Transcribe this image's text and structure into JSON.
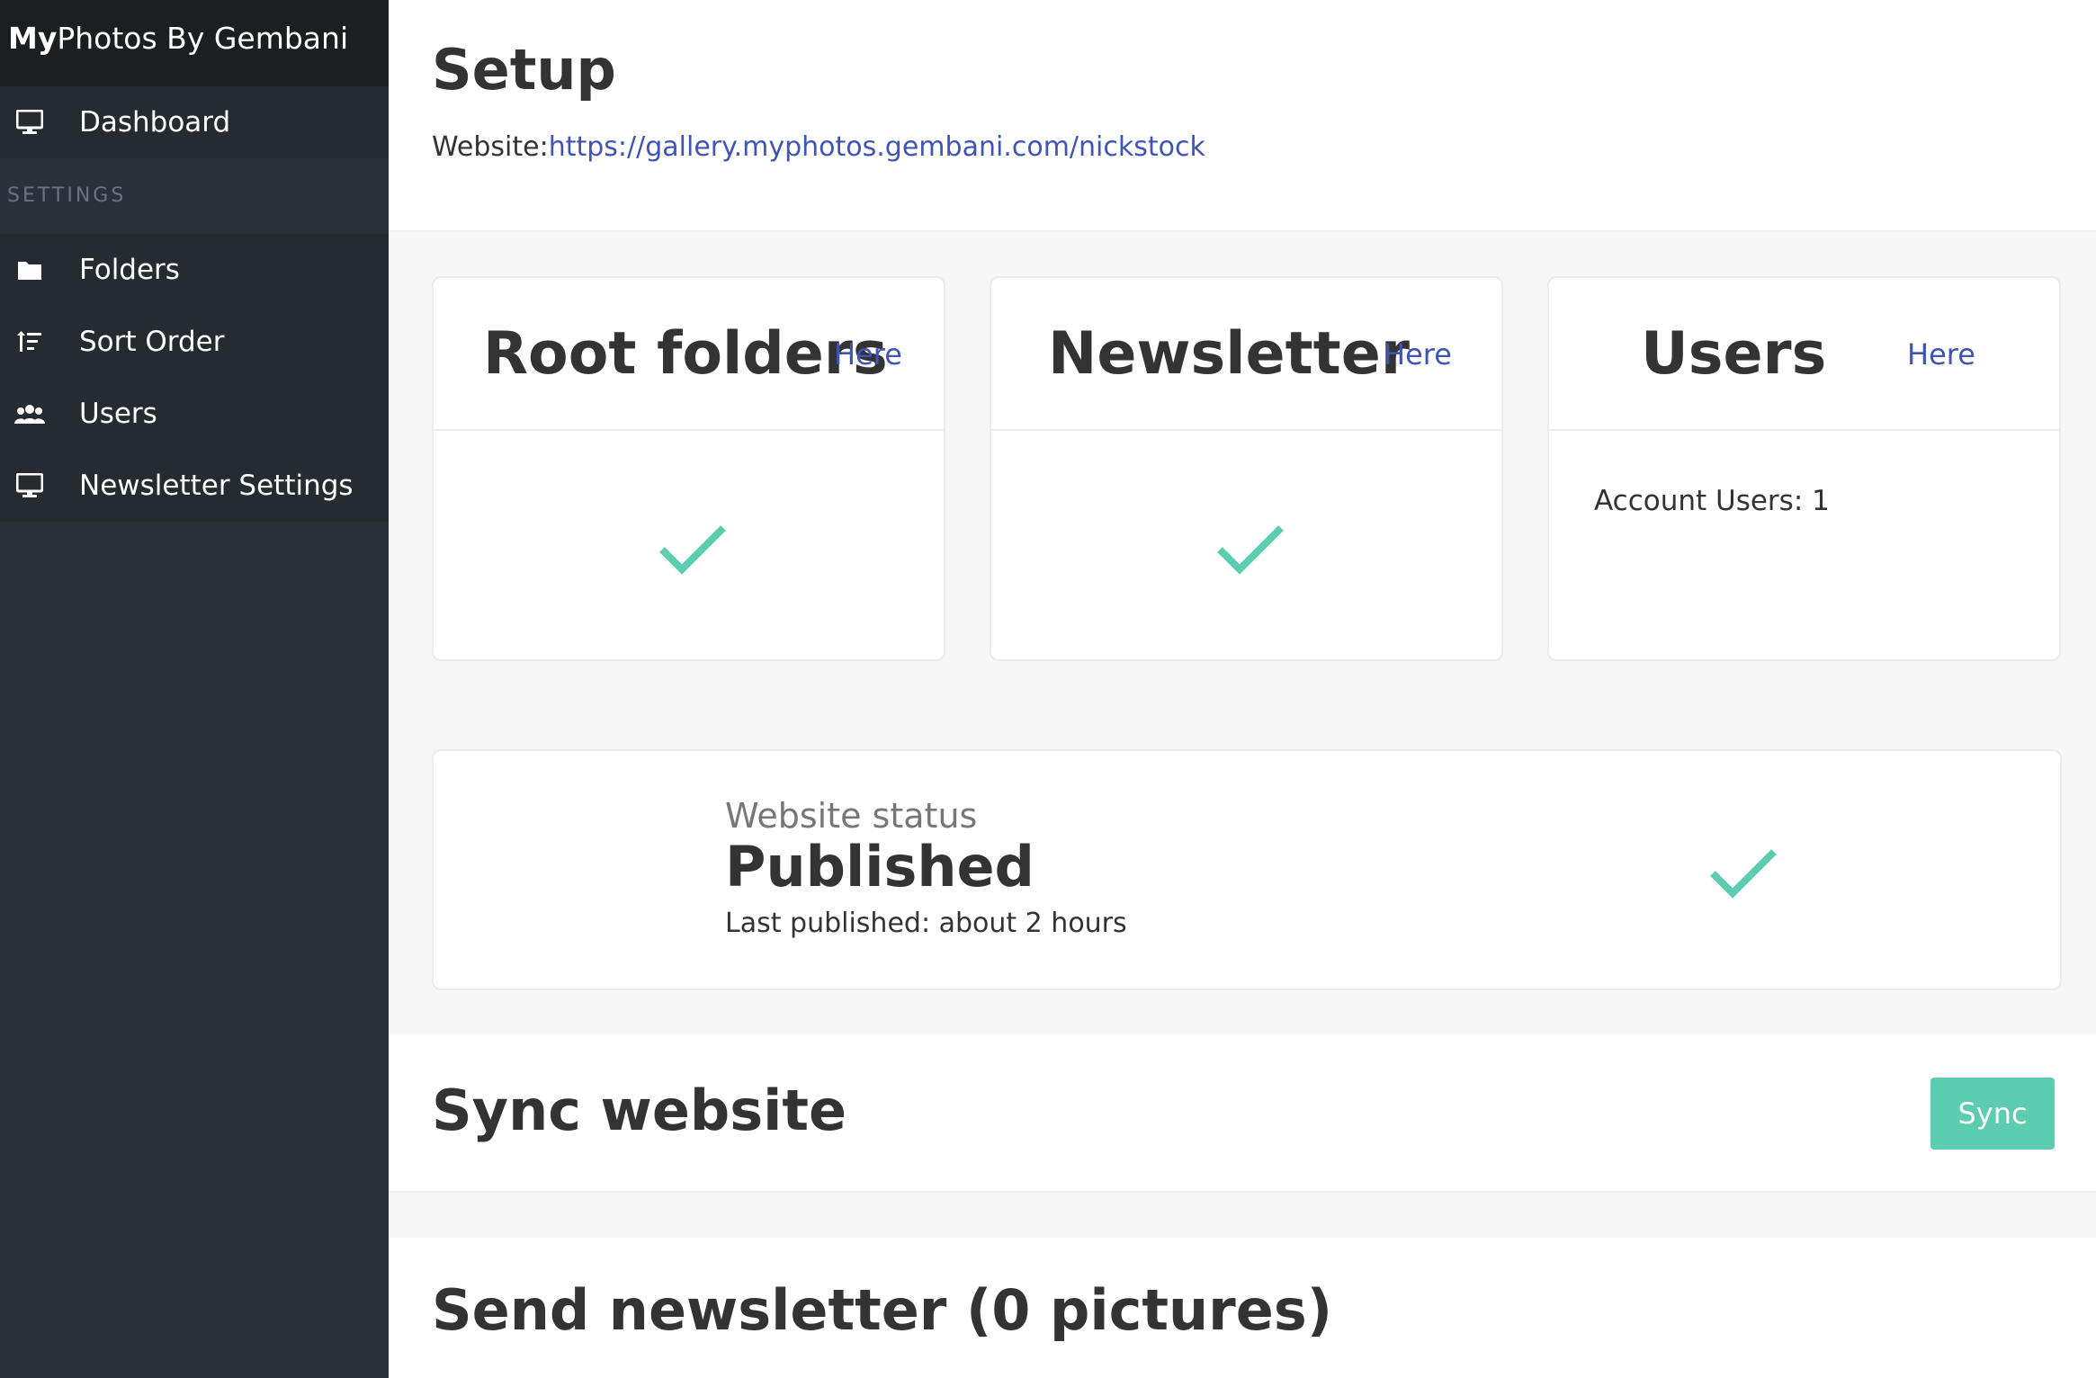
{
  "brand": {
    "bold": "My",
    "rest": "Photos By Gembani"
  },
  "sidebar": {
    "dashboard": {
      "label": "Dashboard",
      "icon": "monitor-icon"
    },
    "section_label": "SETTINGS",
    "items": [
      {
        "label": "Folders",
        "icon": "folder-icon"
      },
      {
        "label": "Sort Order",
        "icon": "sort-icon"
      },
      {
        "label": "Users",
        "icon": "users-icon"
      },
      {
        "label": "Newsletter Settings",
        "icon": "monitor-icon"
      }
    ]
  },
  "header": {
    "title": "Setup",
    "website_label": "Website:",
    "website_url": "https://gallery.myphotos.gembani.com/nickstock"
  },
  "cards": {
    "root_folders": {
      "title": "Root folders",
      "link": "Here",
      "status": "check-icon"
    },
    "newsletter": {
      "title": "Newsletter",
      "link": "Here",
      "status": "check-icon"
    },
    "users": {
      "title": "Users",
      "link": "Here",
      "account_users": "Account Users: 1"
    }
  },
  "status": {
    "label": "Website status",
    "value": "Published",
    "last_published": "Last published: about 2 hours"
  },
  "sync": {
    "title": "Sync website",
    "button": "Sync"
  },
  "newsletter_send": {
    "title": "Send newsletter (0 pictures)"
  },
  "colors": {
    "accent": "#5ccdb0",
    "link": "#3f55b5",
    "sidebar": "#2c303a",
    "brand_bar": "#1c1e22"
  }
}
